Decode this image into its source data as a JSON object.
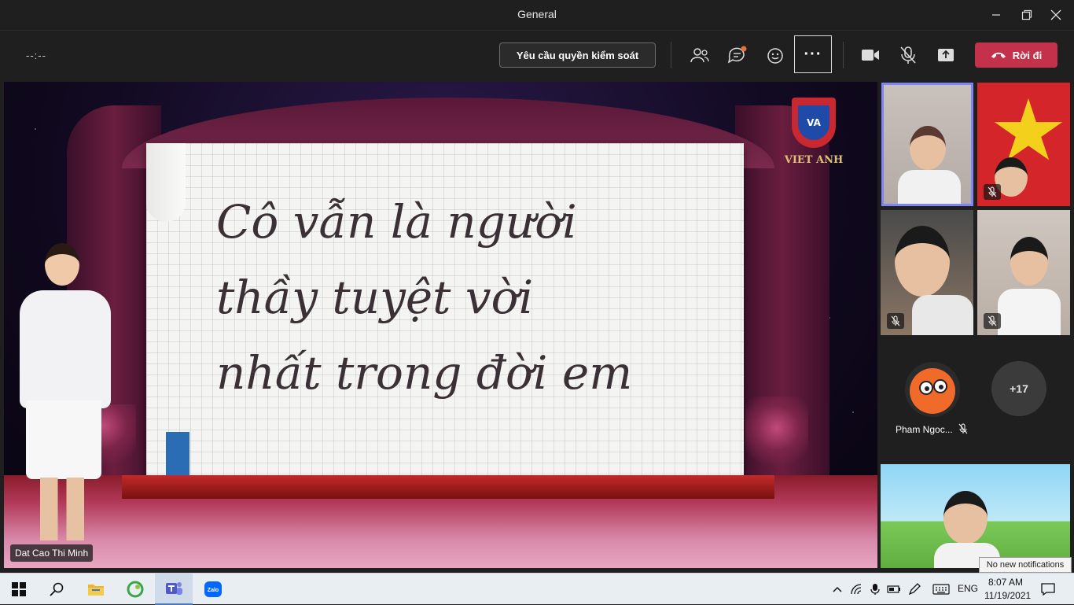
{
  "window": {
    "title": "General"
  },
  "toolbar": {
    "timer": "--:--",
    "request_control_label": "Yêu cầu quyền kiểm soát",
    "more_label": "···",
    "leave_label": "Rời đi"
  },
  "stage": {
    "slide_lines": [
      "Cô vẫn là người",
      "thầy tuyệt vời",
      "nhất trong đời em"
    ],
    "logo_text": "VIET ANH",
    "logo_badge": "VA",
    "presenter_name": "Dat Cao Thi Minh"
  },
  "gallery": {
    "avatar_name": "Pham Ngoc...",
    "overflow_count": "+17"
  },
  "tooltip": {
    "notifications": "No new notifications"
  },
  "taskbar": {
    "language": "ENG",
    "time": "8:07 AM",
    "date": "11/19/2021",
    "zalo_label": "Zalo"
  },
  "colors": {
    "leave_red": "#c4314b",
    "active_speaker_border": "#7f85f5",
    "title_bar": "#1f1f1f",
    "taskbar": "#e9eef3"
  }
}
